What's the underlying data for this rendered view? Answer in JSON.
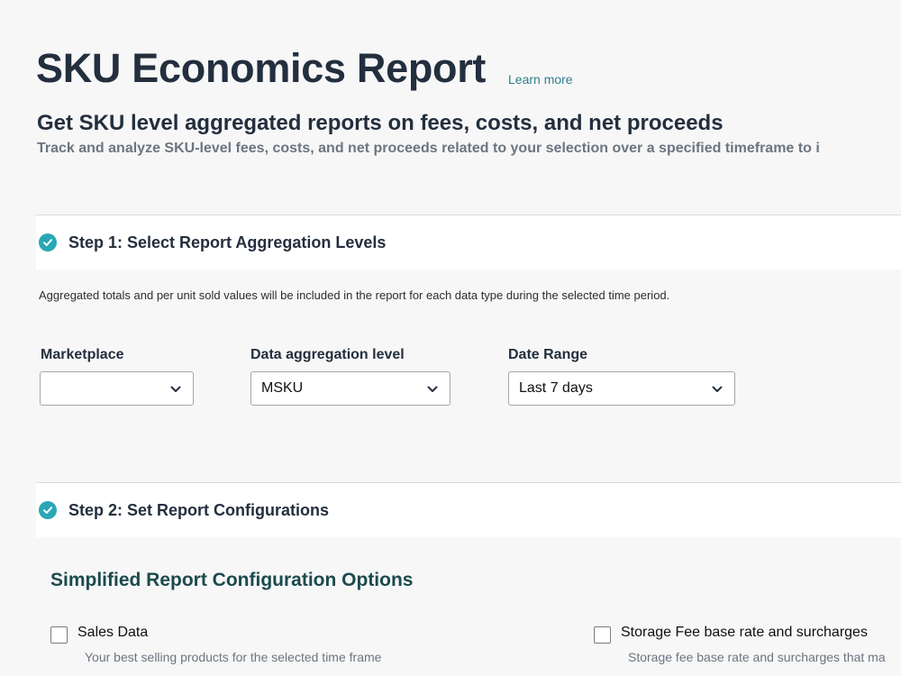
{
  "header": {
    "title": "SKU Economics Report",
    "learn_more": "Learn more",
    "subtitle": "Get SKU level aggregated reports on fees, costs, and net proceeds",
    "description": "Track and analyze SKU-level fees, costs, and net proceeds related to your selection over a specified timeframe to i"
  },
  "step1": {
    "title": "Step 1: Select Report Aggregation Levels",
    "note": "Aggregated totals and per unit sold values will be included in the report for each data type during the selected time period.",
    "fields": [
      {
        "label": "Marketplace",
        "value": ""
      },
      {
        "label": "Data aggregation level",
        "value": "MSKU"
      },
      {
        "label": "Date Range",
        "value": "Last 7 days"
      }
    ]
  },
  "step2": {
    "title": "Step 2: Set Report Configurations",
    "config_title": "Simplified Report Configuration Options",
    "options": [
      {
        "label": "Sales Data",
        "description": "Your best selling products for the selected time frame"
      },
      {
        "label": "Storage Fee base rate and surcharges",
        "description": "Storage fee base rate and surcharges that ma"
      }
    ]
  },
  "colors": {
    "accent": "#2aa7b5",
    "title": "#232f3e",
    "link": "#2f7d8a"
  },
  "icons": {
    "step_status": "check-circle-icon",
    "dropdown": "chevron-down-icon"
  }
}
